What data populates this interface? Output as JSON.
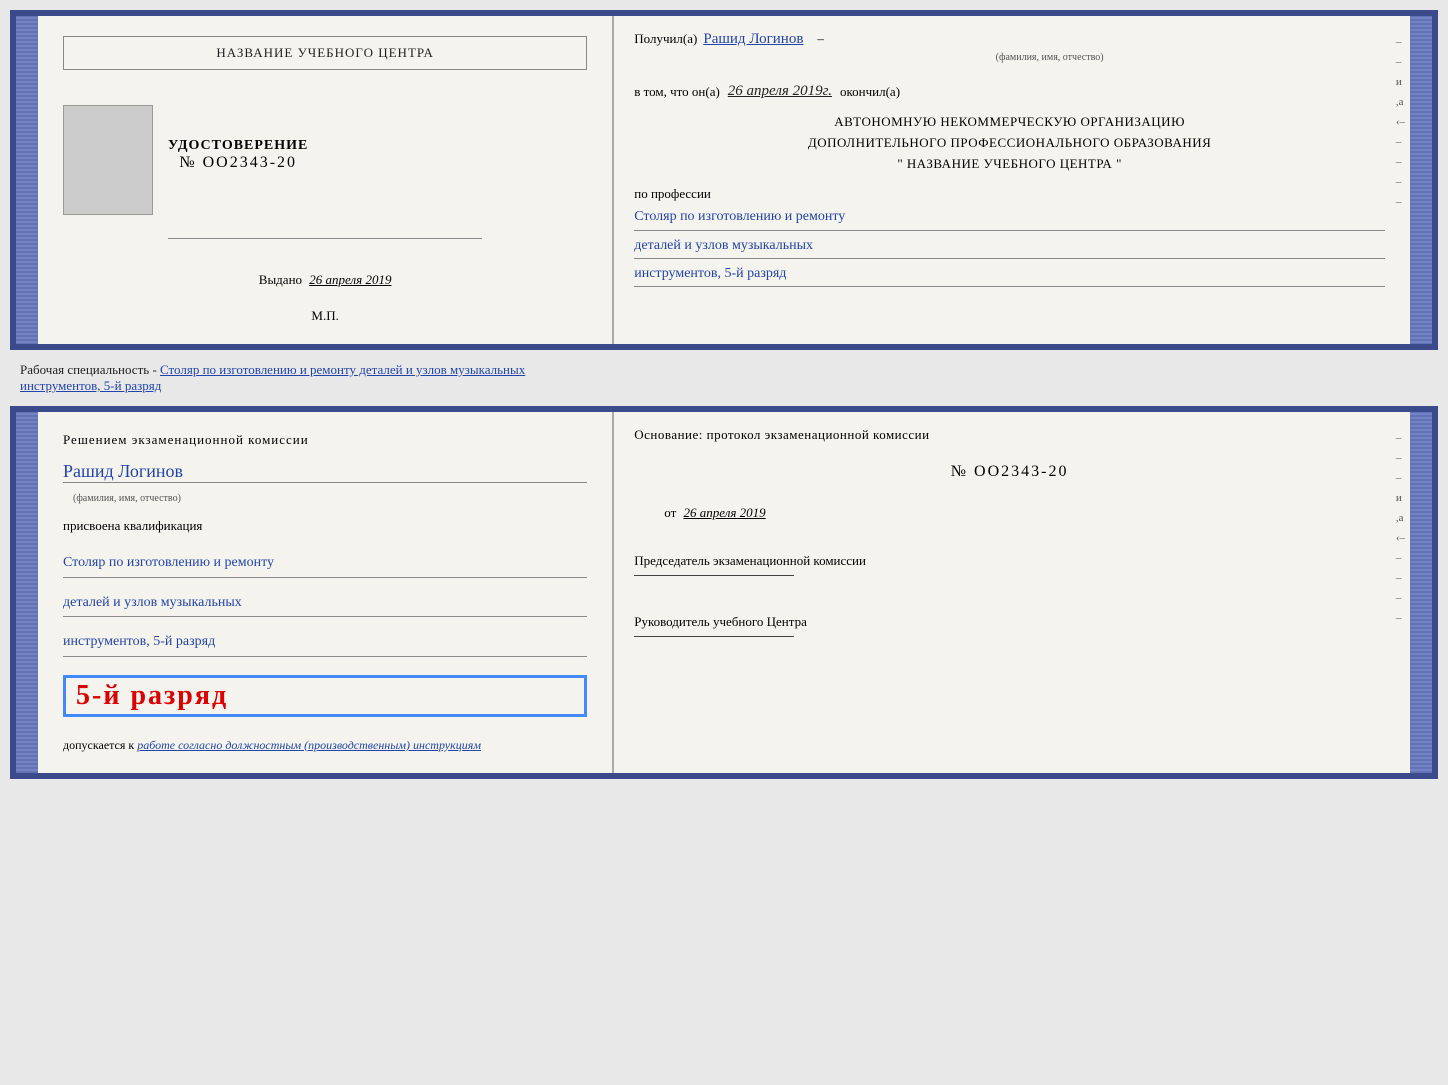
{
  "doc1": {
    "left": {
      "center_name": "НАЗВАНИЕ УЧЕБНОГО ЦЕНТРА",
      "udostoverenie_label": "УДОСТОВЕРЕНИЕ",
      "number": "№ OO2343-20",
      "vydano_label": "Выдано",
      "vydano_date": "26 апреля 2019",
      "mp_label": "М.П."
    },
    "right": {
      "poluchil_label": "Получил(а)",
      "poluchil_name": "Рашид Логинов",
      "fio_caption": "(фамилия, имя, отчество)",
      "vtom_label": "в том, что он(а)",
      "vtom_date": "26 апреля 2019г.",
      "okonchil_label": "окончил(а)",
      "org_line1": "АВТОНОМНУЮ НЕКОММЕРЧЕСКУЮ ОРГАНИЗАЦИЮ",
      "org_line2": "ДОПОЛНИТЕЛЬНОГО ПРОФЕССИОНАЛЬНОГО ОБРАЗОВАНИЯ",
      "org_line3": "\"   НАЗВАНИЕ УЧЕБНОГО ЦЕНТРА   \"",
      "po_professii": "по профессии",
      "profession_line1": "Столяр по изготовлению и ремонту",
      "profession_line2": "деталей и узлов музыкальных",
      "profession_line3": "инструментов, 5-й разряд",
      "side_marks": [
        "–",
        "–",
        "и",
        ",а",
        "‹–",
        "–",
        "–",
        "–",
        "–"
      ]
    }
  },
  "specialty_caption": "Рабочая специальность - Столяр по изготовлению и ремонту деталей и узлов музыкальных инструментов, 5-й разряд",
  "doc2": {
    "left": {
      "resheniem_label": "Решением экзаменационной комиссии",
      "person_name": "Рашид Логинов",
      "fio_caption": "(фамилия, имя, отчество)",
      "prisvoena_label": "присвоена квалификация",
      "qualification_line1": "Столяр по изготовлению и ремонту",
      "qualification_line2": "деталей и узлов музыкальных",
      "qualification_line3": "инструментов, 5-й разряд",
      "highlighted_rank": "5-й разряд",
      "dopuskaetsya_label": "допускается к",
      "dopuskaetsya_text": "работе согласно должностным (производственным) инструкциям"
    },
    "right": {
      "osnovanie_label": "Основание: протокол экзаменационной комиссии",
      "number": "№  OO2343-20",
      "ot_label": "от",
      "date": "26 апреля 2019",
      "chairman_label": "Председатель экзаменационной комиссии",
      "rukovoditel_label": "Руководитель учебного Центра",
      "side_marks": [
        "–",
        "–",
        "–",
        "и",
        ",а",
        "‹–",
        "–",
        "–",
        "–",
        "–"
      ]
    }
  }
}
